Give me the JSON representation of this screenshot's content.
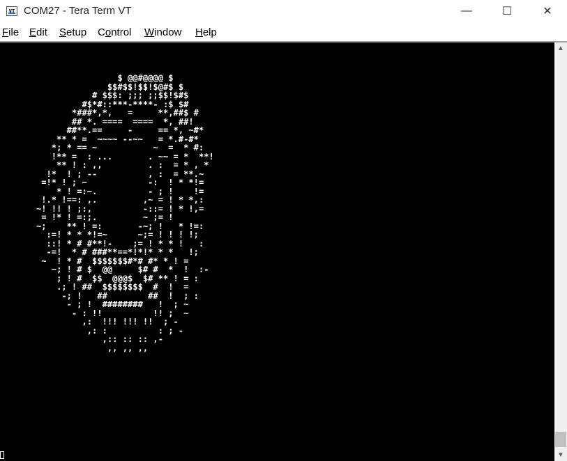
{
  "window": {
    "title": "COM27 - Tera Term VT",
    "app_icon_label": "VT",
    "minimize_glyph": "—",
    "maximize_glyph": "☐",
    "close_glyph": "✕"
  },
  "menu": [
    {
      "mnemonic": "F",
      "rest": "ile"
    },
    {
      "mnemonic": "E",
      "rest": "dit"
    },
    {
      "mnemonic": "S",
      "rest": "etup"
    },
    {
      "prefix": "C",
      "mnemonic": "o",
      "rest": "ntrol"
    },
    {
      "mnemonic": "W",
      "rest": "indow"
    },
    {
      "mnemonic": "H",
      "rest": "elp"
    }
  ],
  "terminal": {
    "background": "#000000",
    "foreground": "#ffffff",
    "lines": [
      "                       $ @@#@@@@ $",
      "                     $$#$$!$$!$@#$ $",
      "                  # $$$: ;;; ;;$$!$#$",
      "                #$*#::***-****- :$ $#",
      "              *###*,*,   =     **,##$ #",
      "              ## *. ====  ====  *, ##!",
      "             ##**.==     -     == *, ~#*",
      "           ** * =  ~~~~ --~~   = *.#-#*",
      "          *; * == ~           ~  =  * #:",
      "          !** =  : ...       . ~~ = *  **!",
      "           ** ! : ,,         . :  = * , *",
      "         !*  ! ; --          , :  = **.~",
      "        =!* ! ; ~            -:  ! * *!=",
      "           * ! =:~.          - ; !    !=",
      "        !.* !==: ,.         ,~ = ! * *,:",
      "       ~! !! ! ;:,          -::= ! * !,=",
      "        = !* ! =:;.         ~ ;= !",
      "       ~;    ** ! =:       -~; !   * !=:",
      "         :=! * * *!=~      ~;= ! ! ! !;",
      "         ::! * # #**!-    ;= ! * * !   :",
      "         -=!  * # ###**==*!*!* * *   !;",
      "        ~  ! * #  $$$$$$$#*# #* * ! =",
      "          ~; ! # $  @@     $# #  *  !  :-",
      "           ; ! #  $$  @@@$  $# ** ! = :",
      "           .; ! ##  $$$$$$$$  #  !  =",
      "            -; !   ##        ##  !  ; :",
      "             - ; !  ########   !  ; ~",
      "              - : !!          !! ;  ~",
      "                ,:  !!! !!! !!  ; -",
      "                 ,: :          : ; -",
      "                    ,:: :: :: ,-",
      "                     ,, ,, ,,"
    ]
  },
  "scrollbar": {
    "up_glyph": "▲",
    "down_glyph": "▼"
  }
}
